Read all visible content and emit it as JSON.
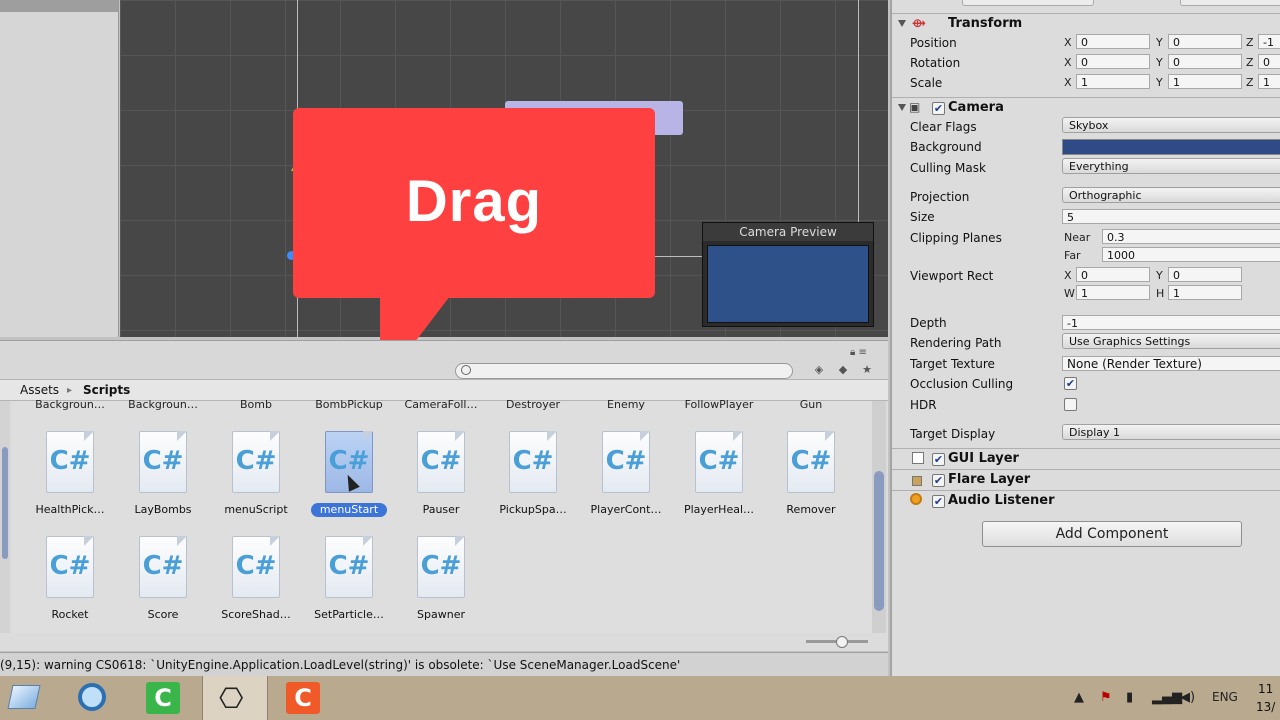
{
  "scene": {
    "camera_preview_title": "Camera Preview"
  },
  "callout": {
    "text": "Drag",
    "color": "#ff4040"
  },
  "project": {
    "breadcrumb": [
      "Assets",
      "Scripts"
    ],
    "breadcrumb_separator": "▸",
    "top_row_labels": [
      "Backgroun…",
      "Backgroun…",
      "Bomb",
      "BombPickup",
      "CameraFoll…",
      "Destroyer",
      "Enemy",
      "FollowPlayer",
      "Gun"
    ],
    "row1": [
      {
        "name": "HealthPick…",
        "selected": false
      },
      {
        "name": "LayBombs",
        "selected": false
      },
      {
        "name": "menuScript",
        "selected": false
      },
      {
        "name": "menuStart",
        "selected": true
      },
      {
        "name": "Pauser",
        "selected": false
      },
      {
        "name": "PickupSpa…",
        "selected": false
      },
      {
        "name": "PlayerCont…",
        "selected": false
      },
      {
        "name": "PlayerHeal…",
        "selected": false
      },
      {
        "name": "Remover",
        "selected": false
      }
    ],
    "row2": [
      {
        "name": "Rocket"
      },
      {
        "name": "Score"
      },
      {
        "name": "ScoreShad…"
      },
      {
        "name": "SetParticle…"
      },
      {
        "name": "Spawner"
      }
    ],
    "file_icon_text": "C#"
  },
  "console": {
    "message": "(9,15): warning CS0618: `UnityEngine.Application.LoadLevel(string)' is obsolete: `Use SceneManager.LoadScene'"
  },
  "inspector": {
    "transform": {
      "title": "Transform",
      "position": {
        "label": "Position",
        "x": "0",
        "y": "0",
        "z": "-1"
      },
      "rotation": {
        "label": "Rotation",
        "x": "0",
        "y": "0",
        "z": "0"
      },
      "scale": {
        "label": "Scale",
        "x": "1",
        "y": "1",
        "z": "1"
      }
    },
    "camera": {
      "title": "Camera",
      "enabled": true,
      "clear_flags": {
        "label": "Clear Flags",
        "value": "Skybox"
      },
      "background": {
        "label": "Background",
        "color": "#2f4a86"
      },
      "culling_mask": {
        "label": "Culling Mask",
        "value": "Everything"
      },
      "projection": {
        "label": "Projection",
        "value": "Orthographic"
      },
      "size": {
        "label": "Size",
        "value": "5"
      },
      "clipping": {
        "label": "Clipping Planes",
        "near_label": "Near",
        "near": "0.3",
        "far_label": "Far",
        "far": "1000"
      },
      "viewport": {
        "label": "Viewport Rect",
        "x": "0",
        "y": "0",
        "w": "1",
        "h": "1"
      },
      "depth": {
        "label": "Depth",
        "value": "-1"
      },
      "rendering_path": {
        "label": "Rendering Path",
        "value": "Use Graphics Settings"
      },
      "target_texture": {
        "label": "Target Texture",
        "value": "None (Render Texture)"
      },
      "occlusion": {
        "label": "Occlusion Culling",
        "checked": true
      },
      "hdr": {
        "label": "HDR",
        "checked": false
      },
      "target_display": {
        "label": "Target Display",
        "value": "Display 1"
      }
    },
    "gui_layer": {
      "title": "GUI Layer",
      "enabled": true
    },
    "flare_layer": {
      "title": "Flare Layer",
      "enabled": true
    },
    "audio_listener": {
      "title": "Audio Listener",
      "enabled": true
    },
    "add_component": "Add Component",
    "axis_labels": {
      "x": "X",
      "y": "Y",
      "z": "Z",
      "w": "W",
      "h": "H"
    }
  },
  "taskbar": {
    "apps": [
      "file-explorer",
      "browser",
      "camtasia-recorder",
      "unity",
      "camtasia-studio"
    ],
    "language": "ENG",
    "clock_line1": "11",
    "clock_line2": "13/"
  }
}
